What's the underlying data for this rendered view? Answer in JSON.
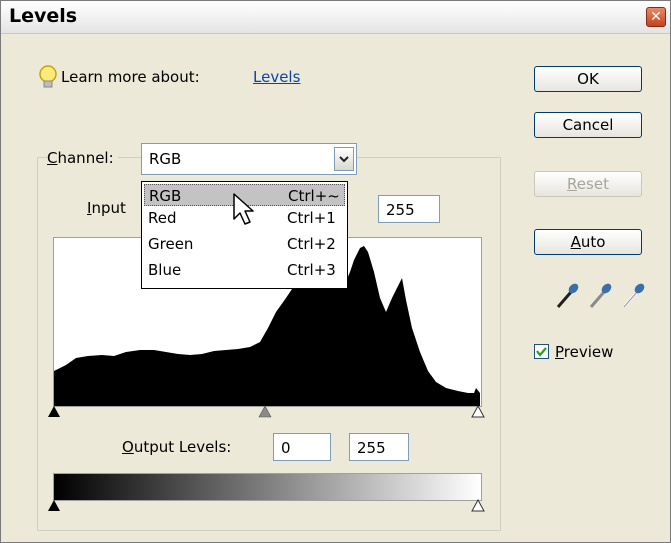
{
  "window": {
    "title": "Levels",
    "close_glyph": "✕"
  },
  "learn": {
    "icon": "lightbulb-icon",
    "text": "Learn more about:",
    "link": "Levels"
  },
  "channel": {
    "label_key": "C",
    "label_rest": "hannel:",
    "value": "RGB"
  },
  "input_levels": {
    "label_key": "I",
    "label_rest": "nput",
    "white": "255"
  },
  "dropdown_options": [
    {
      "label": "RGB",
      "shortcut": "Ctrl+~",
      "selected": true
    },
    {
      "label": "Red",
      "shortcut": "Ctrl+1",
      "selected": false
    },
    {
      "label": "Green",
      "shortcut": "Ctrl+2",
      "selected": false
    },
    {
      "label": "Blue",
      "shortcut": "Ctrl+3",
      "selected": false
    }
  ],
  "output_levels": {
    "label_key": "O",
    "label_rest": "utput Levels:",
    "black": "0",
    "white": "255"
  },
  "buttons": {
    "ok": "OK",
    "cancel": "Cancel",
    "reset_key": "R",
    "reset_rest": "eset",
    "auto_key": "A",
    "auto_rest": "uto"
  },
  "preview": {
    "label_key": "P",
    "label_rest": "review",
    "checked": true
  },
  "colors": {
    "link": "#0645ad",
    "histogram": "#000000",
    "dialog_bg": "#ece9d8",
    "check": "#21a121"
  }
}
